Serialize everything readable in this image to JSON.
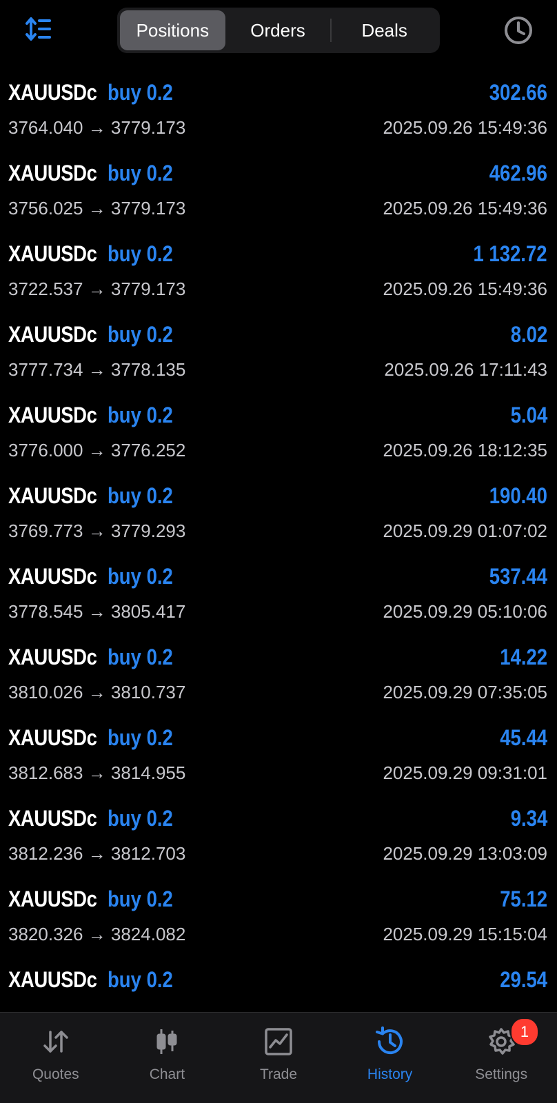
{
  "header": {
    "tabs": [
      {
        "label": "Positions",
        "active": true
      },
      {
        "label": "Orders",
        "active": false
      },
      {
        "label": "Deals",
        "active": false
      }
    ],
    "sort_icon": "sort-icon",
    "history_period_icon": "clock-icon"
  },
  "positions": [
    {
      "symbol": "XAUUSDc",
      "type": "buy 0.2",
      "profit": "302.66",
      "prices": "3764.040 → 3779.173",
      "time": "2025.09.26 15:49:36"
    },
    {
      "symbol": "XAUUSDc",
      "type": "buy 0.2",
      "profit": "462.96",
      "prices": "3756.025 → 3779.173",
      "time": "2025.09.26 15:49:36"
    },
    {
      "symbol": "XAUUSDc",
      "type": "buy 0.2",
      "profit": "1 132.72",
      "prices": "3722.537 → 3779.173",
      "time": "2025.09.26 15:49:36"
    },
    {
      "symbol": "XAUUSDc",
      "type": "buy 0.2",
      "profit": "8.02",
      "prices": "3777.734 → 3778.135",
      "time": "2025.09.26 17:11:43"
    },
    {
      "symbol": "XAUUSDc",
      "type": "buy 0.2",
      "profit": "5.04",
      "prices": "3776.000 → 3776.252",
      "time": "2025.09.26 18:12:35"
    },
    {
      "symbol": "XAUUSDc",
      "type": "buy 0.2",
      "profit": "190.40",
      "prices": "3769.773 → 3779.293",
      "time": "2025.09.29 01:07:02"
    },
    {
      "symbol": "XAUUSDc",
      "type": "buy 0.2",
      "profit": "537.44",
      "prices": "3778.545 → 3805.417",
      "time": "2025.09.29 05:10:06"
    },
    {
      "symbol": "XAUUSDc",
      "type": "buy 0.2",
      "profit": "14.22",
      "prices": "3810.026 → 3810.737",
      "time": "2025.09.29 07:35:05"
    },
    {
      "symbol": "XAUUSDc",
      "type": "buy 0.2",
      "profit": "45.44",
      "prices": "3812.683 → 3814.955",
      "time": "2025.09.29 09:31:01"
    },
    {
      "symbol": "XAUUSDc",
      "type": "buy 0.2",
      "profit": "9.34",
      "prices": "3812.236 → 3812.703",
      "time": "2025.09.29 13:03:09"
    },
    {
      "symbol": "XAUUSDc",
      "type": "buy 0.2",
      "profit": "75.12",
      "prices": "3820.326 → 3824.082",
      "time": "2025.09.29 15:15:04"
    },
    {
      "symbol": "XAUUSDc",
      "type": "buy 0.2",
      "profit": "29.54",
      "prices": "",
      "time": ""
    }
  ],
  "tabbar": {
    "items": [
      {
        "label": "Quotes",
        "icon": "quotes-arrows-icon",
        "active": false
      },
      {
        "label": "Chart",
        "icon": "candlestick-chart-icon",
        "active": false
      },
      {
        "label": "Trade",
        "icon": "trade-chart-icon",
        "active": false
      },
      {
        "label": "History",
        "icon": "history-icon",
        "active": true
      },
      {
        "label": "Settings",
        "icon": "gear-icon",
        "active": false
      }
    ],
    "settings_badge": "1"
  },
  "colors": {
    "accent": "#2a84f0",
    "background": "#000000",
    "secondary_text": "#c7c7cc",
    "tabbar_inactive": "#8e8e93",
    "badge": "#ff3b30"
  }
}
